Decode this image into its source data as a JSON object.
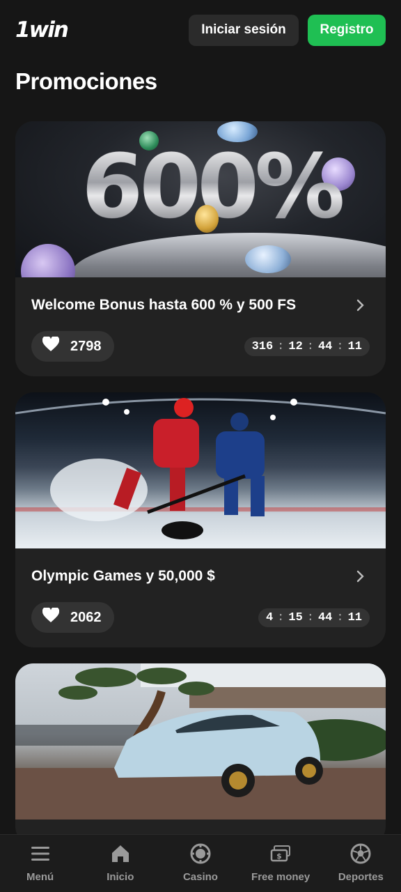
{
  "header": {
    "logo": "1win",
    "login_label": "Iniciar sesión",
    "register_label": "Registro"
  },
  "page": {
    "title": "Promociones"
  },
  "promos": [
    {
      "title": "Welcome Bonus hasta 600 % y 500 FS",
      "likes": "2798",
      "timer": [
        "316",
        "12",
        "44",
        "11"
      ],
      "image_text": "600%"
    },
    {
      "title": "Olympic Games y 50,000 $",
      "likes": "2062",
      "timer": [
        "4",
        "15",
        "44",
        "11"
      ]
    },
    {
      "title": "",
      "likes": "",
      "timer": []
    }
  ],
  "nav": [
    {
      "label": "Menú",
      "icon": "menu-icon"
    },
    {
      "label": "Inicio",
      "icon": "home-icon"
    },
    {
      "label": "Casino",
      "icon": "casino-chip-icon"
    },
    {
      "label": "Free money",
      "icon": "money-icon"
    },
    {
      "label": "Deportes",
      "icon": "soccer-ball-icon"
    }
  ],
  "colors": {
    "accent": "#1fbf53",
    "background": "#161616",
    "card": "#222222"
  }
}
